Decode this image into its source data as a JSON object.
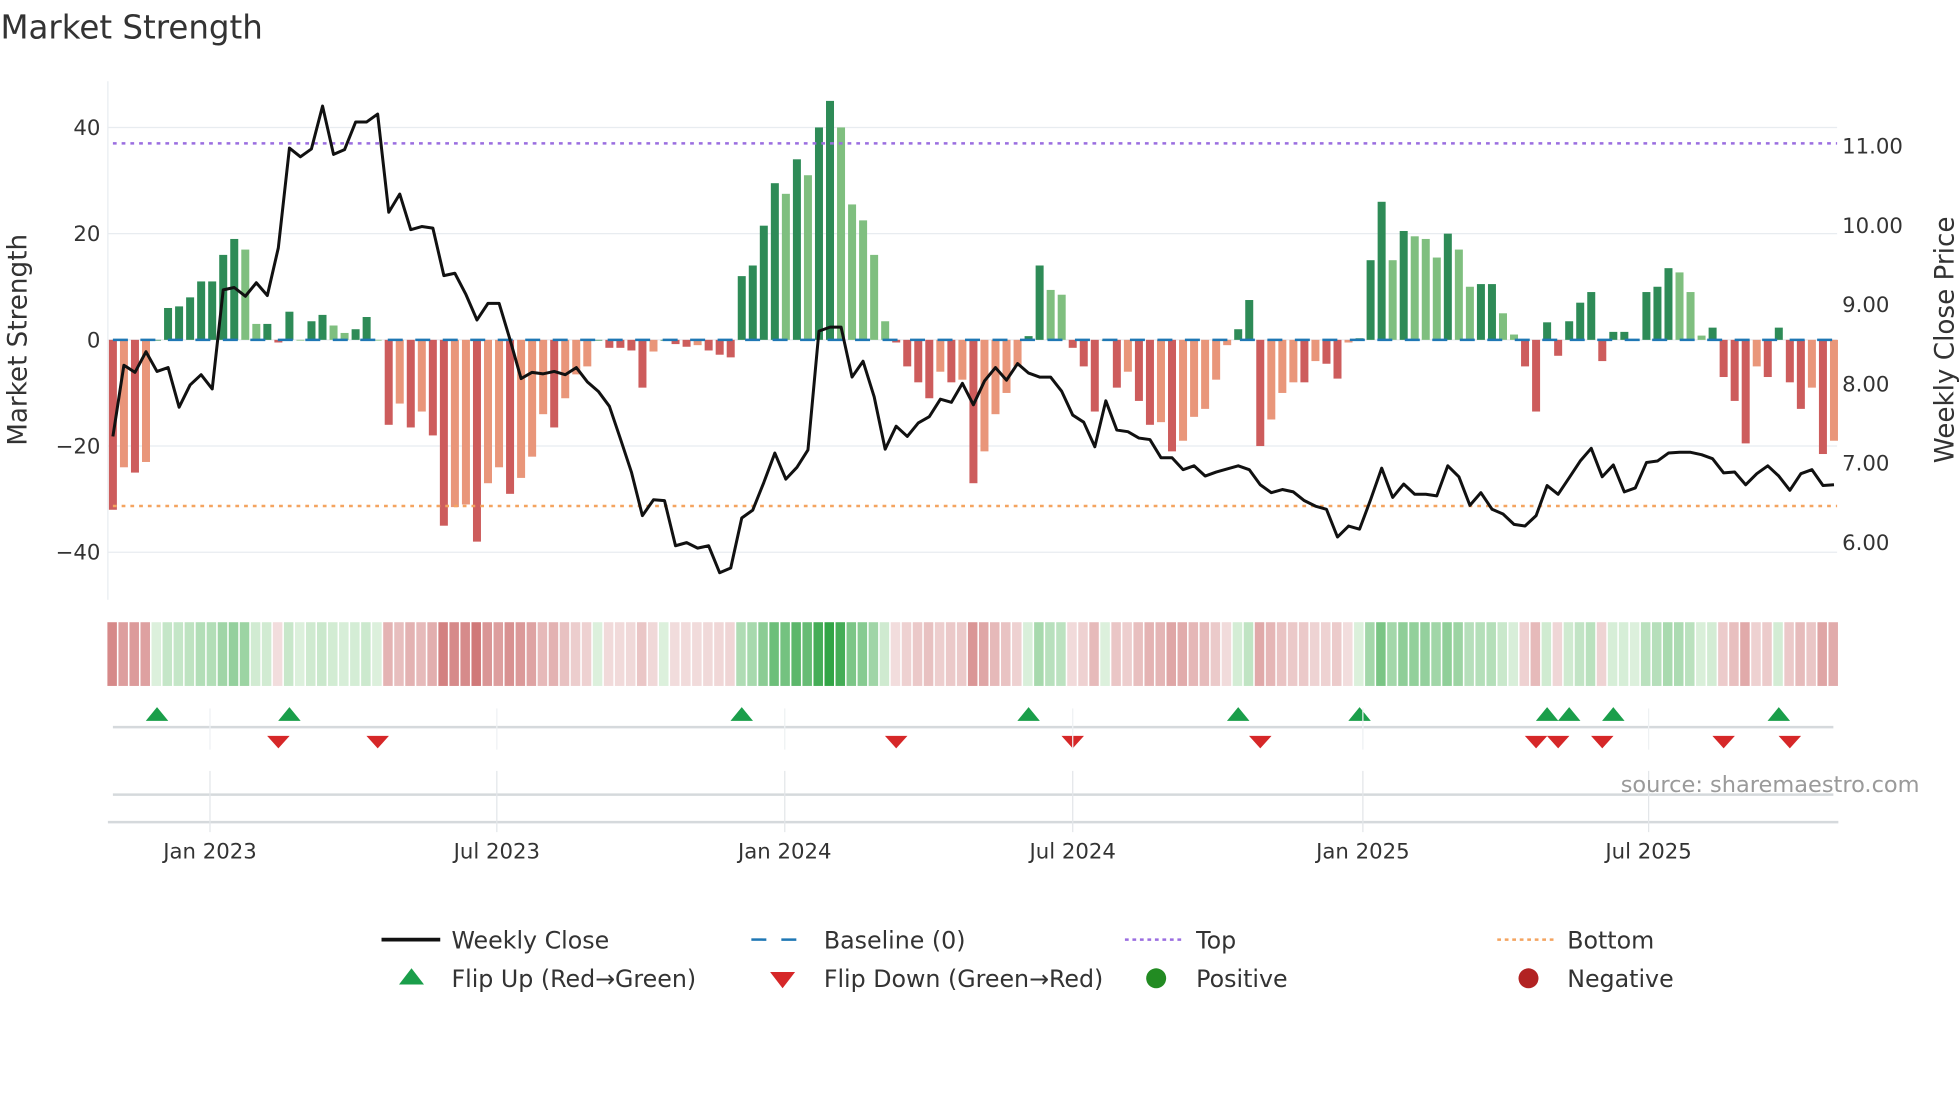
{
  "chart_data": {
    "type": "bar",
    "title": "Market Strength",
    "ylabel": "Market Strength",
    "y2label": "Weekly Close Price",
    "ylim": [
      -48,
      48
    ],
    "y2lim": [
      5.4,
      11.8
    ],
    "yticks": [
      40,
      20,
      0,
      -20,
      -40
    ],
    "ytick_labels": [
      "40",
      "20",
      "0",
      "−20",
      "−40"
    ],
    "y2ticks": [
      11,
      10,
      9,
      8,
      7,
      6
    ],
    "y2tick_labels": [
      "11.00",
      "10.00",
      "9.00",
      "8.00",
      "7.00",
      "6.00"
    ],
    "xticks": [
      {
        "week": 8.8,
        "label": "Jan 2023"
      },
      {
        "week": 34.8,
        "label": "Jul 2023"
      },
      {
        "week": 60.9,
        "label": "Jan 2024"
      },
      {
        "week": 87.0,
        "label": "Jul 2024"
      },
      {
        "week": 113.3,
        "label": "Jan 2025"
      },
      {
        "week": 139.2,
        "label": "Jul 2025"
      }
    ],
    "top_level": 37,
    "bottom_level": -31.3,
    "baseline": 0,
    "strength": [
      -32,
      -24,
      -25,
      -23,
      0,
      6,
      6.3,
      8,
      11,
      11,
      16,
      19,
      17,
      3,
      3,
      -0.5,
      5.3,
      0,
      3.5,
      4.7,
      2.7,
      1.3,
      2,
      4.3,
      0,
      -16,
      -12,
      -16.5,
      -13.5,
      -18,
      -35,
      -31.5,
      -31,
      -38,
      -27,
      -24,
      -29,
      -26,
      -22,
      -14,
      -16.5,
      -11,
      -6.5,
      -5,
      0,
      -1.5,
      -1.5,
      -2,
      -9,
      -2.2,
      0,
      -0.8,
      -1.3,
      -1,
      -2,
      -2.8,
      -3.3,
      12,
      14,
      21.5,
      29.5,
      27.5,
      34,
      31,
      40,
      45,
      40,
      25.5,
      22.5,
      16,
      3.5,
      -0.5,
      -5,
      -8,
      -11,
      -6,
      -8,
      -7.5,
      -27,
      -21,
      -14,
      -10,
      -5,
      0.7,
      14,
      9.4,
      8.5,
      -1.5,
      -5,
      -13.5,
      0,
      -9,
      -6,
      -11.5,
      -16,
      -15.5,
      -21,
      -19,
      -14.5,
      -13,
      -7.5,
      -1,
      2,
      7.5,
      -20,
      -15,
      -10,
      -8,
      -8,
      -4,
      -4.5,
      -7.3,
      -0.5,
      0.3,
      15,
      26,
      15,
      20.5,
      19.5,
      19,
      15.5,
      20,
      17,
      10,
      10.5,
      10.5,
      5,
      1,
      -5,
      -13.5,
      3.3,
      -3,
      3.5,
      7,
      9,
      -4,
      1.5,
      1.5,
      0,
      9,
      10,
      13.5,
      12.7,
      9,
      0.8,
      2.3,
      -7,
      -11.5,
      -19.5,
      -5,
      -7,
      2.3,
      -8,
      -13,
      -9,
      -21.5,
      -19
    ],
    "weekly_close": [
      7.32,
      8.22,
      8.13,
      8.39,
      8.14,
      8.19,
      7.69,
      7.97,
      8.1,
      7.92,
      9.17,
      9.2,
      9.09,
      9.26,
      9.1,
      9.7,
      10.96,
      10.85,
      10.95,
      11.49,
      10.88,
      10.94,
      11.29,
      11.29,
      11.39,
      10.15,
      10.38,
      9.93,
      9.97,
      9.95,
      9.35,
      9.38,
      9.11,
      8.79,
      9.0,
      9.0,
      8.54,
      8.05,
      8.13,
      8.11,
      8.14,
      8.1,
      8.19,
      8.01,
      7.89,
      7.7,
      7.29,
      6.87,
      6.32,
      6.52,
      6.51,
      5.94,
      5.98,
      5.91,
      5.94,
      5.6,
      5.66,
      6.29,
      6.39,
      6.74,
      7.11,
      6.78,
      6.93,
      7.15,
      8.65,
      8.7,
      8.7,
      8.07,
      8.27,
      7.82,
      7.16,
      7.45,
      7.32,
      7.49,
      7.57,
      7.79,
      7.75,
      7.99,
      7.72,
      8.02,
      8.19,
      8.03,
      8.24,
      8.12,
      8.07,
      8.07,
      7.89,
      7.59,
      7.5,
      7.19,
      7.77,
      7.4,
      7.38,
      7.3,
      7.28,
      7.05,
      7.05,
      6.9,
      6.95,
      6.82,
      6.87,
      6.91,
      6.95,
      6.9,
      6.71,
      6.61,
      6.65,
      6.62,
      6.51,
      6.44,
      6.4,
      6.05,
      6.19,
      6.15,
      6.52,
      6.92,
      6.55,
      6.72,
      6.59,
      6.59,
      6.57,
      6.95,
      6.81,
      6.45,
      6.61,
      6.4,
      6.34,
      6.21,
      6.19,
      6.32,
      6.7,
      6.59,
      6.8,
      7.01,
      7.17,
      6.81,
      6.96,
      6.62,
      6.67,
      6.99,
      7.01,
      7.11,
      7.12,
      7.12,
      7.09,
      7.04,
      6.86,
      6.87,
      6.71,
      6.85,
      6.95,
      6.82,
      6.64,
      6.85,
      6.9,
      6.7,
      6.71
    ],
    "flip_up_weeks": [
      4,
      16,
      57,
      83,
      102,
      113,
      130,
      132,
      136,
      151
    ],
    "flip_down_weeks": [
      15,
      24,
      71,
      87,
      104,
      129,
      131,
      135,
      146,
      152
    ],
    "legend": [
      {
        "label": "Weekly Close",
        "kind": "line",
        "color": "#111111"
      },
      {
        "label": "Baseline (0)",
        "kind": "dash",
        "color": "#1f77b4"
      },
      {
        "label": "Top",
        "kind": "dot",
        "color": "#9b6ee0"
      },
      {
        "label": "Bottom",
        "kind": "dot",
        "color": "#f4a460"
      },
      {
        "label": "Flip Up (Red→Green)",
        "kind": "tri-up",
        "color": "#1a9e4a"
      },
      {
        "label": "Flip Down (Green→Red)",
        "kind": "tri-down",
        "color": "#d62728"
      },
      {
        "label": "Positive",
        "kind": "dot-marker",
        "color": "#228b22"
      },
      {
        "label": "Negative",
        "kind": "dot-marker",
        "color": "#b22222"
      }
    ],
    "legend_position": "bottom",
    "source": "source: sharemaestro.com",
    "colors": {
      "pos_strong": "#2e8b57",
      "pos_weak": "#7fbf7f",
      "neg_strong": "#cd5c5c",
      "neg_weak": "#e9967a",
      "grid": "#e8ecf0"
    }
  }
}
